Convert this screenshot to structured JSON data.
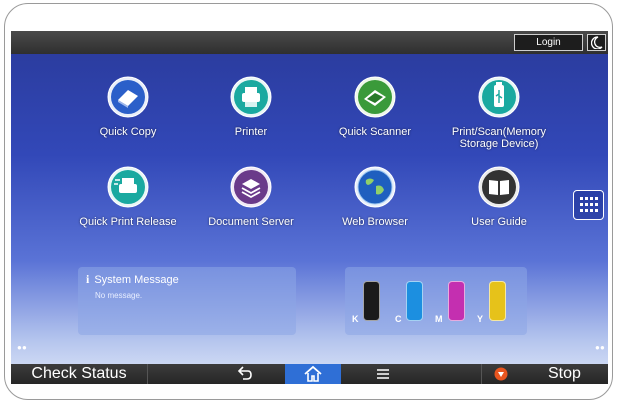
{
  "header": {
    "login_label": "Login",
    "night_icon": "moon-icon"
  },
  "apps": [
    {
      "label": "Quick Copy",
      "icon": "copy-icon",
      "color": "#2b5fc9"
    },
    {
      "label": "Printer",
      "icon": "printer-icon",
      "color": "#1aa9a0"
    },
    {
      "label": "Quick Scanner",
      "icon": "scanner-icon",
      "color": "#3a9a3a"
    },
    {
      "label": "Print/Scan(Memory Storage Device)",
      "icon": "usb-icon",
      "color": "#1aa9a0"
    },
    {
      "label": "Quick Print Release",
      "icon": "print-release-icon",
      "color": "#1aa9a0"
    },
    {
      "label": "Document Server",
      "icon": "document-server-icon",
      "color": "#6a3a8a"
    },
    {
      "label": "Web Browser",
      "icon": "globe-icon",
      "color": "#1f5fbf"
    },
    {
      "label": "User Guide",
      "icon": "book-icon",
      "color": "#333333"
    }
  ],
  "system_message": {
    "title": "System Message",
    "body": "No message."
  },
  "toner": {
    "cartridges": [
      {
        "label": "K",
        "color": "#1a1a1a"
      },
      {
        "label": "C",
        "color": "#1c8fe0"
      },
      {
        "label": "M",
        "color": "#c42fb0"
      },
      {
        "label": "Y",
        "color": "#e6c21a"
      }
    ]
  },
  "bottom": {
    "check_status": "Check Status",
    "stop": "Stop"
  }
}
